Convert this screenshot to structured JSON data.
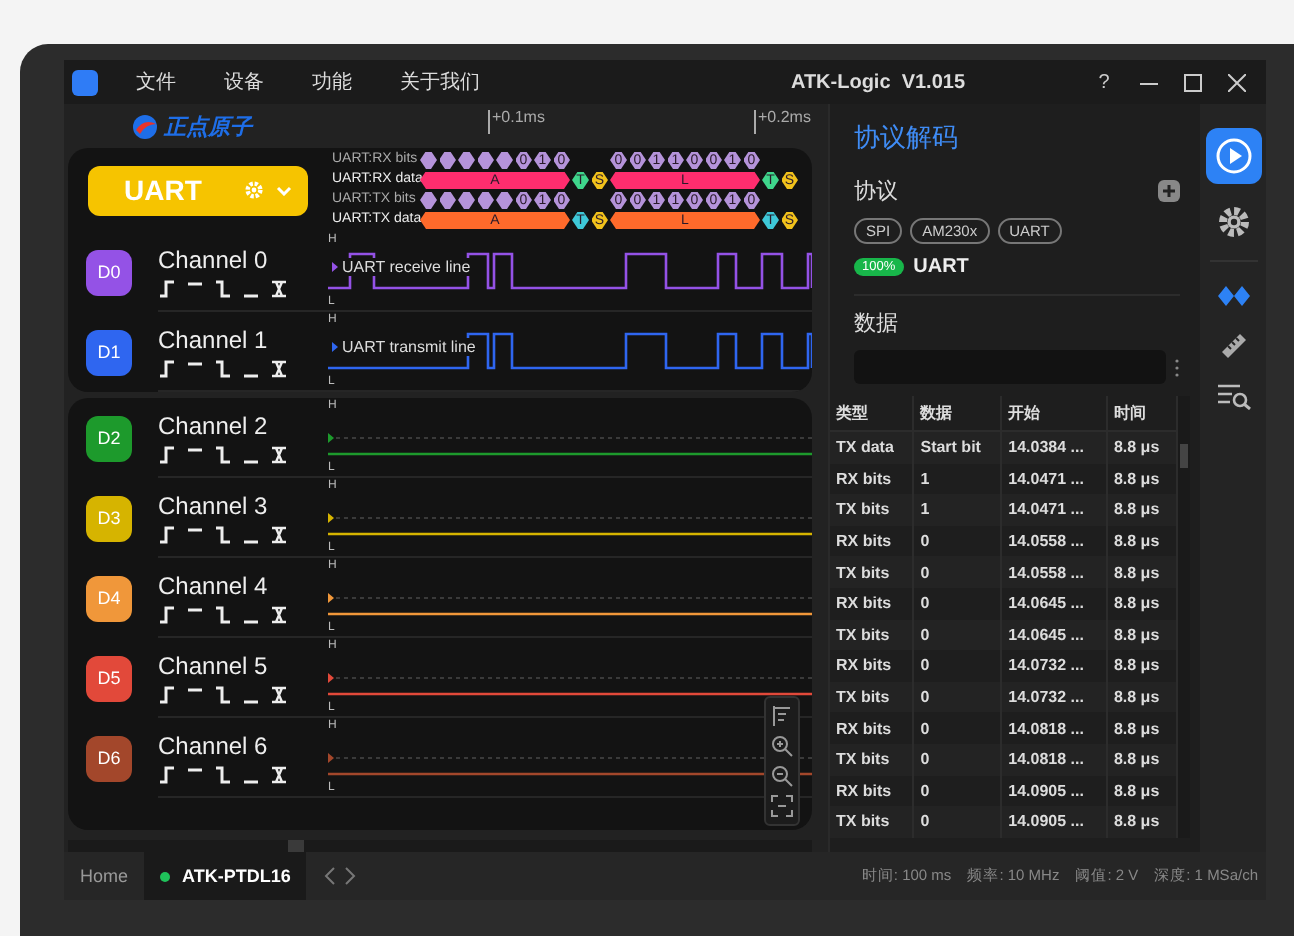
{
  "window": {
    "title": "ATK-Logic  V1.015",
    "help": "?"
  },
  "menu": [
    "文件",
    "设备",
    "功能",
    "关于我们"
  ],
  "logo": {
    "text": "正点原子"
  },
  "timeline": {
    "ticks": [
      "+0.1ms",
      "+0.2ms"
    ]
  },
  "decoder_button": {
    "label": "UART"
  },
  "decode_rows": [
    {
      "label": "UART:RX bits",
      "kind": "bits",
      "groups": [
        [
          {
            "kind": "blank"
          },
          {
            "kind": "blank"
          },
          {
            "kind": "blank"
          },
          {
            "kind": "blank"
          },
          {
            "kind": "blank"
          },
          {
            "kind": "bit",
            "text": "0"
          },
          {
            "kind": "bit",
            "text": "1"
          },
          {
            "kind": "bit",
            "text": "0"
          }
        ],
        [
          {
            "kind": "bit",
            "text": "0"
          },
          {
            "kind": "bit",
            "text": "0"
          },
          {
            "kind": "bit",
            "text": "1"
          },
          {
            "kind": "bit",
            "text": "1"
          },
          {
            "kind": "bit",
            "text": "0"
          },
          {
            "kind": "bit",
            "text": "0"
          },
          {
            "kind": "bit",
            "text": "1"
          },
          {
            "kind": "bit",
            "text": "0"
          }
        ]
      ]
    },
    {
      "label": "UART:RX data",
      "kind": "data",
      "color": "#ff2d6e",
      "groups": [
        [
          {
            "kind": "byte",
            "text": "A"
          },
          {
            "kind": "stop",
            "text": "T",
            "color": "#3fd68c"
          },
          {
            "kind": "start",
            "text": "S",
            "color": "#f2c21b"
          },
          {
            "kind": "byte",
            "text": "L"
          },
          {
            "kind": "stop",
            "text": "T",
            "color": "#3fd68c"
          },
          {
            "kind": "start",
            "text": "S",
            "color": "#f2c21b"
          }
        ]
      ]
    },
    {
      "label": "UART:TX bits",
      "kind": "bits",
      "groups": [
        [
          {
            "kind": "blank"
          },
          {
            "kind": "blank"
          },
          {
            "kind": "blank"
          },
          {
            "kind": "blank"
          },
          {
            "kind": "blank"
          },
          {
            "kind": "bit",
            "text": "0"
          },
          {
            "kind": "bit",
            "text": "1"
          },
          {
            "kind": "bit",
            "text": "0"
          }
        ],
        [
          {
            "kind": "bit",
            "text": "0"
          },
          {
            "kind": "bit",
            "text": "0"
          },
          {
            "kind": "bit",
            "text": "1"
          },
          {
            "kind": "bit",
            "text": "1"
          },
          {
            "kind": "bit",
            "text": "0"
          },
          {
            "kind": "bit",
            "text": "0"
          },
          {
            "kind": "bit",
            "text": "1"
          },
          {
            "kind": "bit",
            "text": "0"
          }
        ]
      ]
    },
    {
      "label": "UART:TX data",
      "kind": "data",
      "color": "#ff6a2b",
      "groups": [
        [
          {
            "kind": "byte",
            "text": "A"
          },
          {
            "kind": "stop",
            "text": "T",
            "color": "#3ec8d8"
          },
          {
            "kind": "start",
            "text": "S",
            "color": "#f2c21b"
          },
          {
            "kind": "byte",
            "text": "L"
          },
          {
            "kind": "stop",
            "text": "T",
            "color": "#3ec8d8"
          },
          {
            "kind": "start",
            "text": "S",
            "color": "#f2c21b"
          }
        ]
      ]
    }
  ],
  "channel_groups": [
    {
      "channels": [
        {
          "id": "D0",
          "name": "Channel 0",
          "color": "#9452e6",
          "kind": "active",
          "annotation": "UART receive line",
          "high_label": "H",
          "low_label": "L"
        },
        {
          "id": "D1",
          "name": "Channel 1",
          "color": "#2f66f0",
          "kind": "active",
          "annotation": "UART transmit line",
          "high_label": "H",
          "low_label": "L"
        }
      ]
    },
    {
      "channels": [
        {
          "id": "D2",
          "name": "Channel 2",
          "color": "#1d9a2c",
          "kind": "idle",
          "high_label": "H",
          "low_label": "L"
        },
        {
          "id": "D3",
          "name": "Channel 3",
          "color": "#d6b400",
          "kind": "idle",
          "high_label": "H",
          "low_label": "L"
        },
        {
          "id": "D4",
          "name": "Channel 4",
          "color": "#f0973a",
          "kind": "idle",
          "high_label": "H",
          "low_label": "L"
        },
        {
          "id": "D5",
          "name": "Channel 5",
          "color": "#e2493a",
          "kind": "idle",
          "high_label": "H",
          "low_label": "L"
        },
        {
          "id": "D6",
          "name": "Channel 6",
          "color": "#a3472b",
          "kind": "idle",
          "high_label": "H",
          "low_label": "L"
        }
      ]
    }
  ],
  "panel": {
    "title": "协议解码",
    "protocol_heading": "协议",
    "protocols": [
      "SPI",
      "AM230x",
      "UART"
    ],
    "active_decoder": {
      "progress": "100%",
      "name": "UART"
    },
    "data_heading": "数据"
  },
  "table": {
    "columns": [
      "类型",
      "数据",
      "开始",
      "时间"
    ],
    "rows": [
      [
        "TX data",
        "Start bit",
        "14.0384 ...",
        "8.8 μs"
      ],
      [
        "RX bits",
        "1",
        "14.0471 ...",
        "8.8 μs"
      ],
      [
        "TX bits",
        "1",
        "14.0471 ...",
        "8.8 μs"
      ],
      [
        "RX bits",
        "0",
        "14.0558 ...",
        "8.8 μs"
      ],
      [
        "TX bits",
        "0",
        "14.0558 ...",
        "8.8 μs"
      ],
      [
        "RX bits",
        "0",
        "14.0645 ...",
        "8.8 μs"
      ],
      [
        "TX bits",
        "0",
        "14.0645 ...",
        "8.8 μs"
      ],
      [
        "RX bits",
        "0",
        "14.0732 ...",
        "8.8 μs"
      ],
      [
        "TX bits",
        "0",
        "14.0732 ...",
        "8.8 μs"
      ],
      [
        "RX bits",
        "0",
        "14.0818 ...",
        "8.8 μs"
      ],
      [
        "TX bits",
        "0",
        "14.0818 ...",
        "8.8 μs"
      ],
      [
        "RX bits",
        "0",
        "14.0905 ...",
        "8.8 μs"
      ],
      [
        "TX bits",
        "0",
        "14.0905 ...",
        "8.8 μs"
      ]
    ]
  },
  "tabs": [
    {
      "label": "Home",
      "selected": false,
      "connected": false
    },
    {
      "label": "ATK-PTDL16",
      "selected": true,
      "connected": true
    }
  ],
  "status_bar": [
    "时间: 100 ms",
    "频率: 10 MHz",
    "阈值: 2 V",
    "深度: 1 MSa/ch"
  ]
}
